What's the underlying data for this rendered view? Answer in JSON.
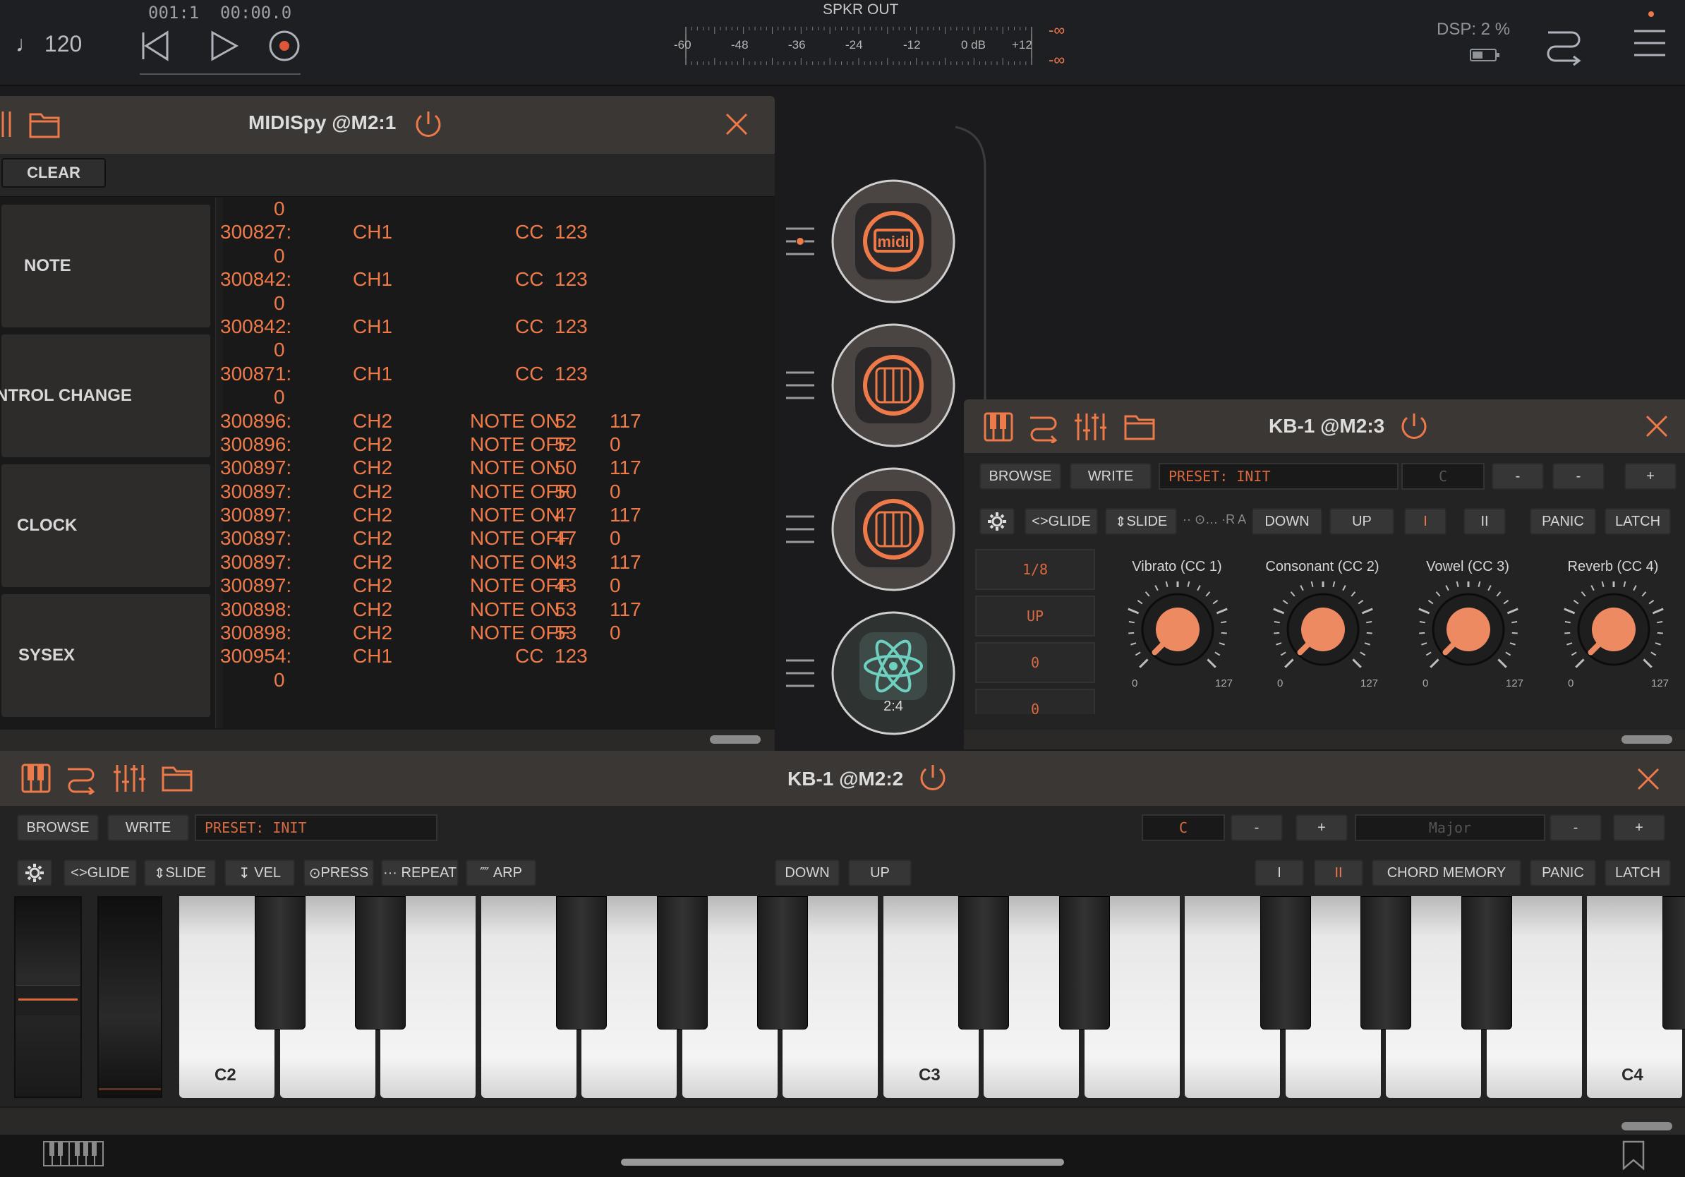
{
  "topbar": {
    "tempo": "120",
    "position": "001:1",
    "time": "00:00.0",
    "output_label": "SPKR OUT",
    "meter_ticks": [
      "-60",
      "-48",
      "-36",
      "-24",
      "-12",
      "0 dB",
      "+12"
    ],
    "peak_left": "-∞",
    "peak_right": "-∞",
    "dsp": "DSP:  2 %"
  },
  "midispy": {
    "title": "MIDISpy @M2:1",
    "clear_label": "CLEAR",
    "filters": [
      "NOTE",
      "NTROL CHANGE",
      "CLOCK",
      "SYSEX"
    ],
    "log": [
      [
        "0",
        "",
        "",
        "",
        ""
      ],
      [
        "300827:",
        "CH1",
        "CC",
        "123",
        ""
      ],
      [
        "0",
        "",
        "",
        "",
        ""
      ],
      [
        "300842:",
        "CH1",
        "CC",
        "123",
        ""
      ],
      [
        "0",
        "",
        "",
        "",
        ""
      ],
      [
        "300842:",
        "CH1",
        "CC",
        "123",
        ""
      ],
      [
        "0",
        "",
        "",
        "",
        ""
      ],
      [
        "300871:",
        "CH1",
        "CC",
        "123",
        ""
      ],
      [
        "0",
        "",
        "",
        "",
        ""
      ],
      [
        "300896:",
        "CH2",
        "NOTE ON",
        "52",
        "117"
      ],
      [
        "300896:",
        "CH2",
        "NOTE OFF",
        "52",
        "0"
      ],
      [
        "300897:",
        "CH2",
        "NOTE ON",
        "50",
        "117"
      ],
      [
        "300897:",
        "CH2",
        "NOTE OFF",
        "50",
        "0"
      ],
      [
        "300897:",
        "CH2",
        "NOTE ON",
        "47",
        "117"
      ],
      [
        "300897:",
        "CH2",
        "NOTE OFF",
        "47",
        "0"
      ],
      [
        "300897:",
        "CH2",
        "NOTE ON",
        "43",
        "117"
      ],
      [
        "300897:",
        "CH2",
        "NOTE OFF",
        "43",
        "0"
      ],
      [
        "300898:",
        "CH2",
        "NOTE ON",
        "53",
        "117"
      ],
      [
        "300898:",
        "CH2",
        "NOTE OFF",
        "53",
        "0"
      ],
      [
        "300954:",
        "CH1",
        "CC",
        "123",
        ""
      ],
      [
        "0",
        "",
        "",
        "",
        ""
      ]
    ]
  },
  "chain": {
    "bottom_label": "2:4"
  },
  "kb3": {
    "title": "KB-1 @M2:3",
    "browse": "BROWSE",
    "write": "WRITE",
    "preset": "PRESET:  INIT",
    "key": "C",
    "minus": "-",
    "minus2": "-",
    "plus": "+",
    "glide": "GLIDE",
    "slide": "SLIDE",
    "dots": "·· ⊙…  ·R A",
    "down": "DOWN",
    "up": "UP",
    "i": "I",
    "ii": "II",
    "panic": "PANIC",
    "latch": "LATCH",
    "arp_values": [
      "1/8",
      "UP",
      "0",
      "0"
    ],
    "knobs": [
      {
        "label": "Vibrato (CC 1)",
        "min": "0",
        "max": "127"
      },
      {
        "label": "Consonant (CC 2)",
        "min": "0",
        "max": "127"
      },
      {
        "label": "Vowel (CC 3)",
        "min": "0",
        "max": "127"
      },
      {
        "label": "Reverb (CC 4)",
        "min": "0",
        "max": "127"
      }
    ]
  },
  "kb2": {
    "title": "KB-1 @M2:2",
    "browse": "BROWSE",
    "write": "WRITE",
    "preset": "PRESET:  INIT",
    "key": "C",
    "minus": "-",
    "plus": "+",
    "scale": "Major",
    "scale_minus": "-",
    "scale_plus": "+",
    "glide": "GLIDE",
    "slide": "SLIDE",
    "vel": "VEL",
    "press": "PRESS",
    "repeat": "REPEAT",
    "arp": "ARP",
    "down": "DOWN",
    "up": "UP",
    "i": "I",
    "ii": "II",
    "chord_memory": "CHORD MEMORY",
    "panic": "PANIC",
    "latch": "LATCH",
    "octave_labels": [
      "C2",
      "C3",
      "C4"
    ]
  },
  "colors": {
    "accent": "#ee7a4a",
    "panel_header": "#3a3734",
    "background": "#1b1b1d"
  }
}
